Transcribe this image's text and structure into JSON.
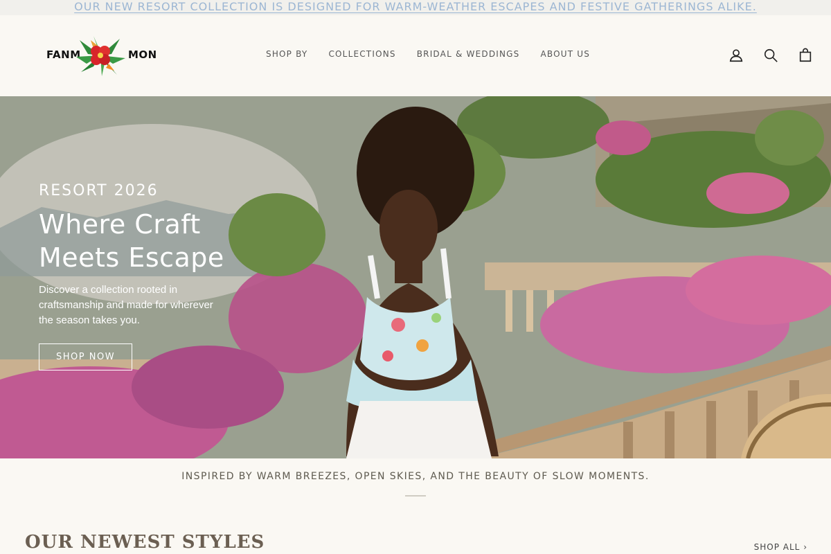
{
  "announcement": {
    "text": "OUR NEW RESORT COLLECTION IS DESIGNED FOR WARM-WEATHER ESCAPES AND FESTIVE GATHERINGS ALIKE."
  },
  "header": {
    "logo_left": "FANM",
    "logo_right": "MON",
    "nav": [
      "SHOP BY",
      "COLLECTIONS",
      "BRIDAL & WEDDINGS",
      "ABOUT US"
    ],
    "icons": [
      "account-icon",
      "search-icon",
      "cart-icon"
    ]
  },
  "hero": {
    "eyebrow": "RESORT 2026",
    "title": "Where Craft Meets Escape",
    "text": "Discover a collection rooted in craftsmanship and made for wherever the season takes you.",
    "button": "SHOP NOW"
  },
  "tagline": "INSPIRED BY WARM BREEZES, OPEN SKIES, AND THE BEAUTY OF SLOW MOMENTS.",
  "section": {
    "title": "OUR NEWEST STYLES",
    "link": "SHOP ALL"
  },
  "colors": {
    "background": "#faf8f3",
    "announcement_link": "#9cb6d3",
    "section_title": "#6b5f52"
  }
}
